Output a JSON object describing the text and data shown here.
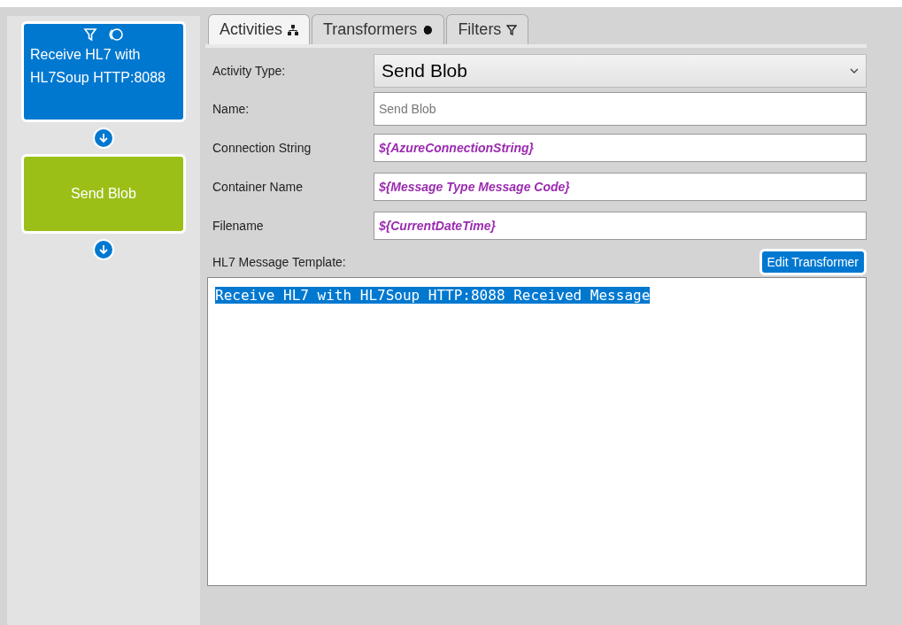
{
  "workflow": {
    "nodes": [
      {
        "label": "Receive HL7 with HL7Soup HTTP:8088",
        "color": "#0078d0",
        "kind": "receiver"
      },
      {
        "label": "Send Blob",
        "color": "#9bbf17",
        "kind": "activity"
      }
    ]
  },
  "tabs": [
    {
      "label": "Activities",
      "selected": true,
      "kind": "activities"
    },
    {
      "label": "Transformers",
      "selected": false,
      "kind": "transformers"
    },
    {
      "label": "Filters",
      "selected": false,
      "kind": "filters"
    }
  ],
  "form": {
    "fields": [
      {
        "label": "Activity Type:",
        "kind": "select",
        "value": "Send Blob"
      },
      {
        "label": "Name:",
        "kind": "text",
        "placeholder": "Send Blob"
      },
      {
        "label": "Connection String",
        "kind": "variable",
        "value": "${AzureConnectionString}"
      },
      {
        "label": "Container Name",
        "kind": "variable",
        "value": "${Message Type Message Code}"
      },
      {
        "label": "Filename",
        "kind": "variable",
        "value": "${CurrentDateTime}"
      }
    ],
    "template_label": "HL7 Message Template:",
    "edit_button": "Edit Transformer",
    "template": {
      "text": "Receive HL7 with HL7Soup HTTP:8088 Received Message",
      "selected": true
    }
  }
}
